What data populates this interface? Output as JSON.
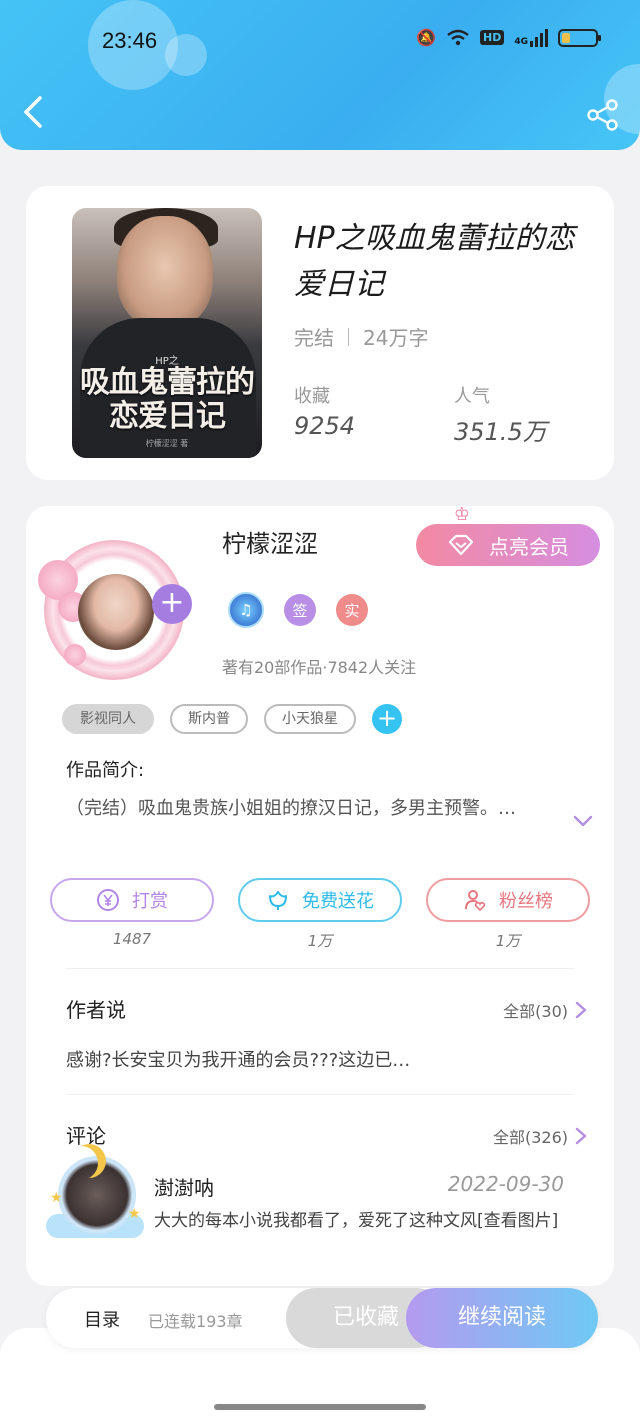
{
  "status": {
    "time": "23:46",
    "network": "4G",
    "hd": "HD",
    "battery_level": 0.25
  },
  "book": {
    "title": "HP之吸血鬼蕾拉的恋爱日记",
    "status": "完结",
    "word_count": "24万字",
    "favorites_label": "收藏",
    "favorites_value": "9254",
    "popularity_label": "人气",
    "popularity_value": "351.5万",
    "cover": {
      "small": "HP之",
      "title": "吸血鬼蕾拉的恋爱日记",
      "author": "柠檬涩涩 著"
    }
  },
  "author": {
    "name": "柠檬涩涩",
    "vip_label": "点亮会员",
    "badges": [
      "music-badge",
      "签",
      "实"
    ],
    "stats": "著有20部作品·7842人关注"
  },
  "tags": [
    "影视同人",
    "斯内普",
    "小天狼星"
  ],
  "intro": {
    "title": "作品简介:",
    "text": "（完结）吸血鬼贵族小姐姐的撩汉日记，多男主预警。…"
  },
  "actions": [
    {
      "label": "打赏",
      "count": "1487"
    },
    {
      "label": "免费送花",
      "count": "1万"
    },
    {
      "label": "粉丝榜",
      "count": "1万"
    }
  ],
  "author_says": {
    "title": "作者说",
    "more": "全部(30)",
    "text": "感谢?长安宝贝为我开通的会员???这边已…"
  },
  "comments": {
    "title": "评论",
    "more": "全部(326)",
    "items": [
      {
        "name": "澍澍呐",
        "date": "2022-09-30",
        "text": "大大的每本小说我都看了，爱死了这种文风[查看图片]"
      }
    ]
  },
  "bottom": {
    "toc": "目录",
    "serial": "已连载193章",
    "collected": "已收藏",
    "read": "继续阅读"
  },
  "colors": {
    "header": "#3aaef0",
    "accent_purple": "#a57de0",
    "read_gradient_start": "#b49af0",
    "read_gradient_end": "#6fc9f4"
  }
}
